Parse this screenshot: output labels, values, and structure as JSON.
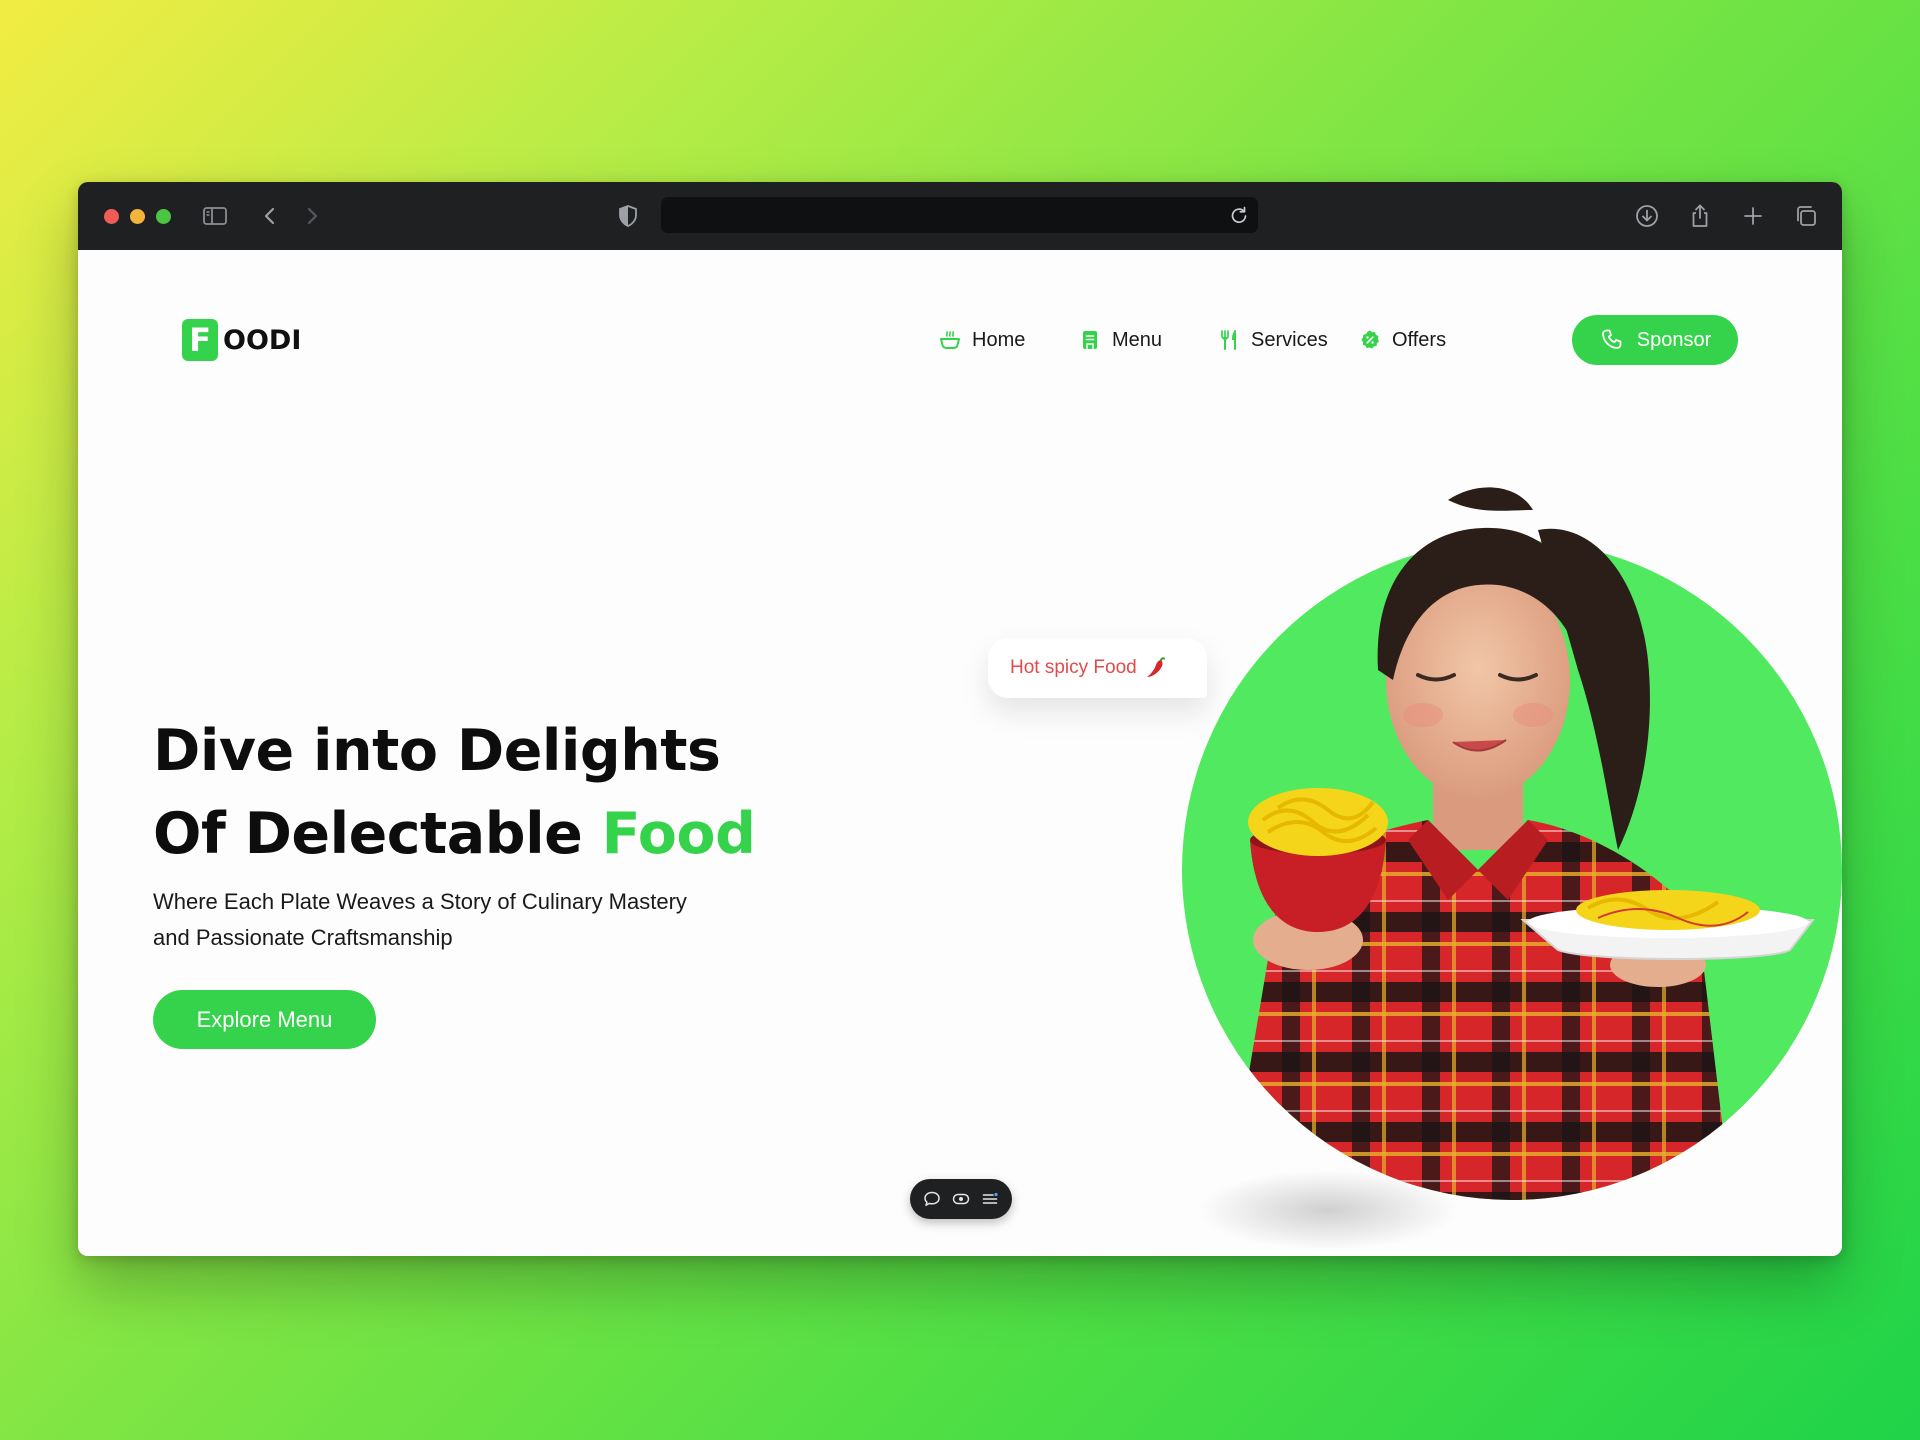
{
  "browser": {
    "url": "",
    "icons": [
      "sidebar-toggle-icon",
      "back-icon",
      "forward-icon",
      "shield-icon",
      "reload-icon",
      "download-icon",
      "share-icon",
      "new-tab-icon",
      "tabs-overview-icon"
    ]
  },
  "brand": {
    "logo_letter": "F",
    "logo_text": "OODI",
    "accent_color": "#35d34b"
  },
  "nav": {
    "items": [
      {
        "label": "Home",
        "icon": "bowl-icon"
      },
      {
        "label": "Menu",
        "icon": "menu-book-icon"
      },
      {
        "label": "Services",
        "icon": "fork-knife-icon"
      },
      {
        "label": "Offers",
        "icon": "discount-badge-icon"
      }
    ],
    "sponsor_label": "Sponsor",
    "sponsor_icon": "phone-icon"
  },
  "hero": {
    "title_line1": "Dive into Delights",
    "title_line2_prefix": "Of Delectable ",
    "title_line2_accent": "Food",
    "subtitle": "Where Each Plate Weaves a Story of Culinary Mastery and Passionate Craftsmanship",
    "cta_label": "Explore Menu",
    "bubble_text": "Hot spicy Food",
    "bubble_icon": "chili-icon",
    "image_description_icon": "woman-with-noodles-illustration"
  },
  "floating_toolbar": {
    "icons": [
      "comment-icon",
      "eye-icon",
      "list-icon"
    ]
  }
}
